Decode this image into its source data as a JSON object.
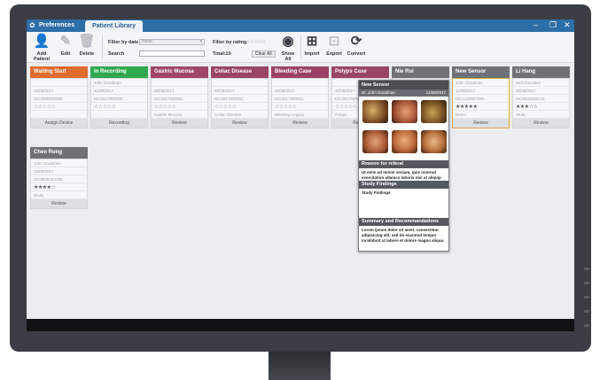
{
  "app": {
    "title": "Preferences",
    "active_tab": "Patient Library"
  },
  "toolbar": {
    "add_patient": "Add Patient",
    "edit": "Edit",
    "delete": "Delete",
    "filter_by_date_label": "Filter by date",
    "filter_by_date_value": "None",
    "search_label": "Search",
    "filter_by_rating_label": "Filter by rating",
    "rating_stars": "☆☆☆☆☆",
    "total": "Total:10",
    "clear_all": "Clear All",
    "show_all": "Show All",
    "import": "Import",
    "export": "Export",
    "convert": "Convert"
  },
  "columns": [
    {
      "title": "Waiting Start",
      "color": "#e06b2e"
    },
    {
      "title": "In Recording",
      "color": "#2fa84f"
    },
    {
      "title": "Gastric Mucosa",
      "color": "#a0456a"
    },
    {
      "title": "Celiac Disease",
      "color": "#9a4466"
    },
    {
      "title": "Bleeding Case",
      "color": "#9b4167"
    },
    {
      "title": "Polyps Case",
      "color": "#9a4466"
    },
    {
      "title": "Nie Rui",
      "color": "#6e7277"
    },
    {
      "title": "New Sensor",
      "color": "#6e7277"
    },
    {
      "title": "Li Hang",
      "color": "#6e7277"
    }
  ],
  "cards": [
    {
      "name": "",
      "date": "12/05/2017",
      "id": "ISC2000000000",
      "stars": "☆☆☆☆☆",
      "note": "",
      "footer": "Assign Device"
    },
    {
      "name": "John Goodman",
      "date": "11/08/2017",
      "id": "ISC6427900000",
      "stars": "☆☆☆☆☆",
      "note": "",
      "footer": "Recording"
    },
    {
      "name": "",
      "date": "30/08/2017",
      "id": "ISC2017090001",
      "stars": "☆☆☆☆☆",
      "note": "Gastric Mucosa",
      "footer": "Review"
    },
    {
      "name": "",
      "date": "30/08/2017",
      "id": "ISC2017090001",
      "stars": "☆☆☆☆☆",
      "note": "Celiac Disease",
      "footer": "Review"
    },
    {
      "name": "",
      "date": "30/08/2017",
      "id": "ISC2017090001",
      "stars": "☆☆☆☆☆",
      "note": "Bleeding Legacy",
      "footer": "Review"
    },
    {
      "name": "",
      "date": "30/08/2017",
      "id": "ISC2017090001",
      "stars": "☆☆☆☆☆",
      "note": "Polyps",
      "footer": "Review"
    },
    {
      "name": "",
      "date": "",
      "id": "",
      "stars": "",
      "note": "",
      "footer": "Review"
    },
    {
      "name": "John Goodman",
      "date": "11/08/2017",
      "id": "ISC1234567890",
      "stars": "★★★★★",
      "note": "Demo",
      "footer": "Review"
    },
    {
      "name": "Neil Gonzalez",
      "date": "20/05/2017",
      "id": "ISC0944636416",
      "stars": "★★★☆☆",
      "note": "Study",
      "footer": "Review"
    }
  ],
  "extra_column": {
    "title": "Chen Rong",
    "color": "#6e7277"
  },
  "extra_card": {
    "name": "John Goodman",
    "date": "16/05/2017",
    "id": "ISC9646453706",
    "stars": "★★★★☆",
    "note": "Study",
    "footer": "Review"
  },
  "popup": {
    "title": "New Sensor",
    "doctor": "Dr. John Goodman",
    "date": "11/08/2017",
    "reason_title": "Reason for referal",
    "reason_text": "Ut enim ad minim veniam, quis nostrud exercitation ullamco laboris nisi ut aliquip ex",
    "findings_title": "Study Findings",
    "findings_text": "Study Findings",
    "summary_title": "Summary and Recommandations",
    "summary_text": "Lorem ipsum dolor sit amet, consectetur adipisicing elit, sed do eiusmod tempor incididunt ut labore et dolore magna aliqua."
  }
}
